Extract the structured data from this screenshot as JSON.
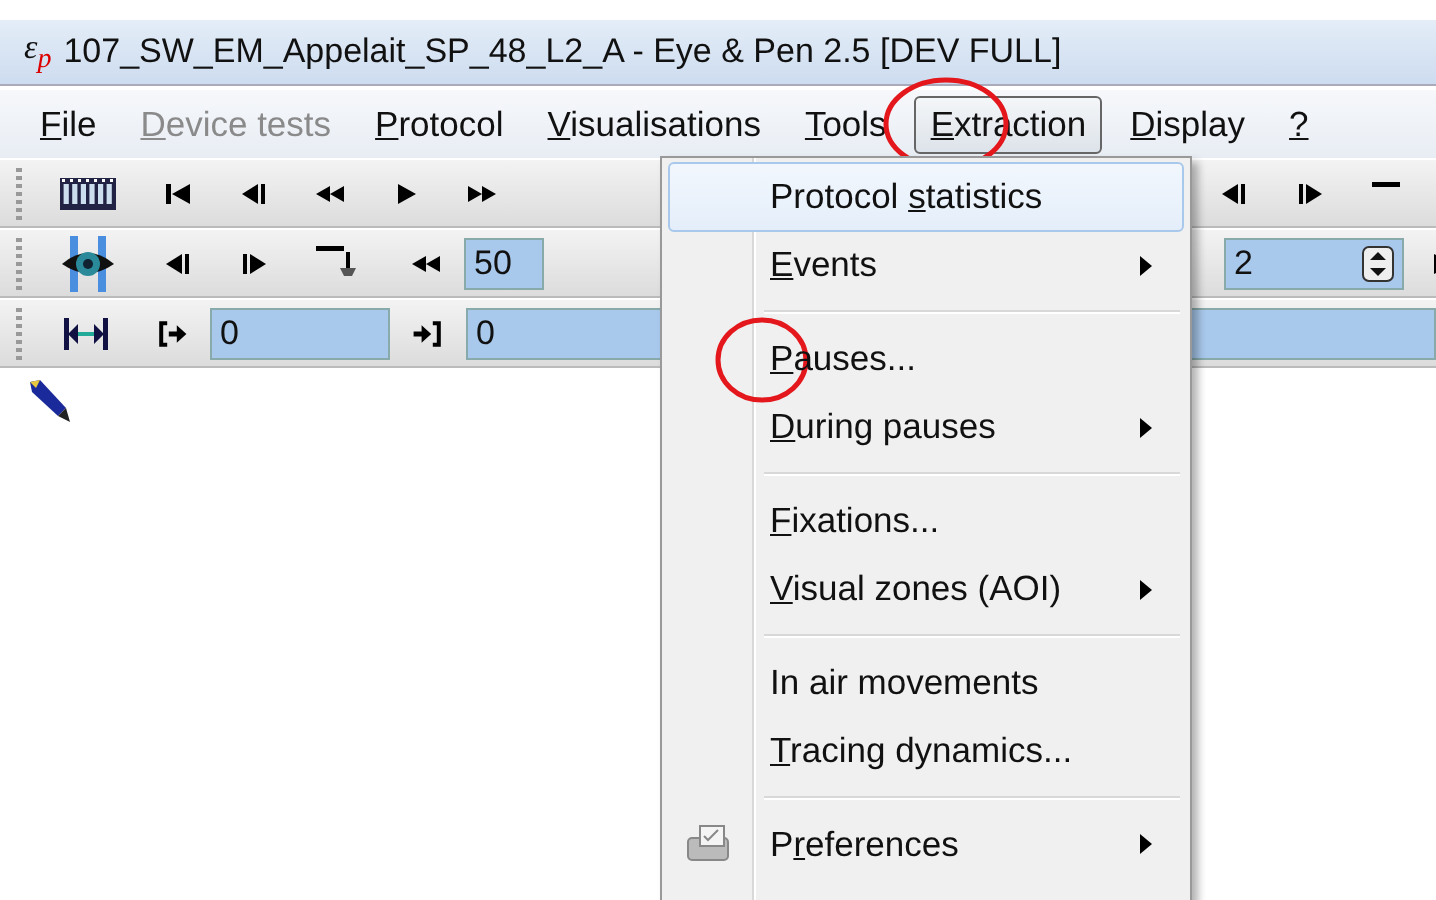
{
  "window": {
    "app_icon": "ε$_{p}$",
    "title": "107_SW_EM_Appelait_SP_48_L2_A - Eye & Pen 2.5 [DEV FULL]"
  },
  "menubar": [
    {
      "key": "F",
      "post": "ile",
      "disabled": false,
      "selected": false
    },
    {
      "key": "D",
      "post": "evice tests",
      "disabled": true,
      "selected": false
    },
    {
      "key": "P",
      "post": "rotocol",
      "disabled": false,
      "selected": false
    },
    {
      "key": "V",
      "post": "isualisations",
      "disabled": false,
      "selected": false
    },
    {
      "key": "T",
      "post": "ools",
      "disabled": false,
      "selected": false
    },
    {
      "key": "E",
      "post": "xtraction",
      "disabled": false,
      "selected": true,
      "circled": true
    },
    {
      "key": "D",
      "post": "isplay",
      "disabled": false,
      "selected": false
    },
    {
      "key": "?",
      "disabled": false,
      "selected": false
    }
  ],
  "toolbar_fields": [
    {
      "kind": "text",
      "value": "50"
    },
    {
      "kind": "spin",
      "value": "2"
    },
    {
      "kind": "text",
      "value": "0"
    },
    {
      "kind": "text",
      "value": "0"
    }
  ],
  "menu": [
    {
      "kind": "item",
      "pre": "Protocol ",
      "key": "s",
      "post": "tatistics",
      "submenu": false,
      "selected": true
    },
    {
      "kind": "item",
      "key": "E",
      "post": "vents",
      "submenu": true,
      "selected": false
    },
    {
      "kind": "separator"
    },
    {
      "kind": "item",
      "key": "P",
      "post": "auses...",
      "submenu": false,
      "selected": false,
      "circled": true
    },
    {
      "kind": "item",
      "key": "D",
      "post": "uring pauses",
      "submenu": true,
      "selected": false
    },
    {
      "kind": "separator"
    },
    {
      "kind": "item",
      "key": "F",
      "post": "ixations...",
      "submenu": false,
      "selected": false
    },
    {
      "kind": "item",
      "key": "V",
      "post": "isual zones (AOI)",
      "submenu": true,
      "selected": false
    },
    {
      "kind": "separator"
    },
    {
      "kind": "item",
      "pre": "In air movements",
      "submenu": false,
      "selected": false
    },
    {
      "kind": "item",
      "key": "T",
      "post": "racing dynamics...",
      "submenu": false,
      "selected": false
    },
    {
      "kind": "separator"
    },
    {
      "kind": "icon_item",
      "pre": "P",
      "key": "r",
      "post": "eferences",
      "submenu": true,
      "selected": false
    }
  ]
}
